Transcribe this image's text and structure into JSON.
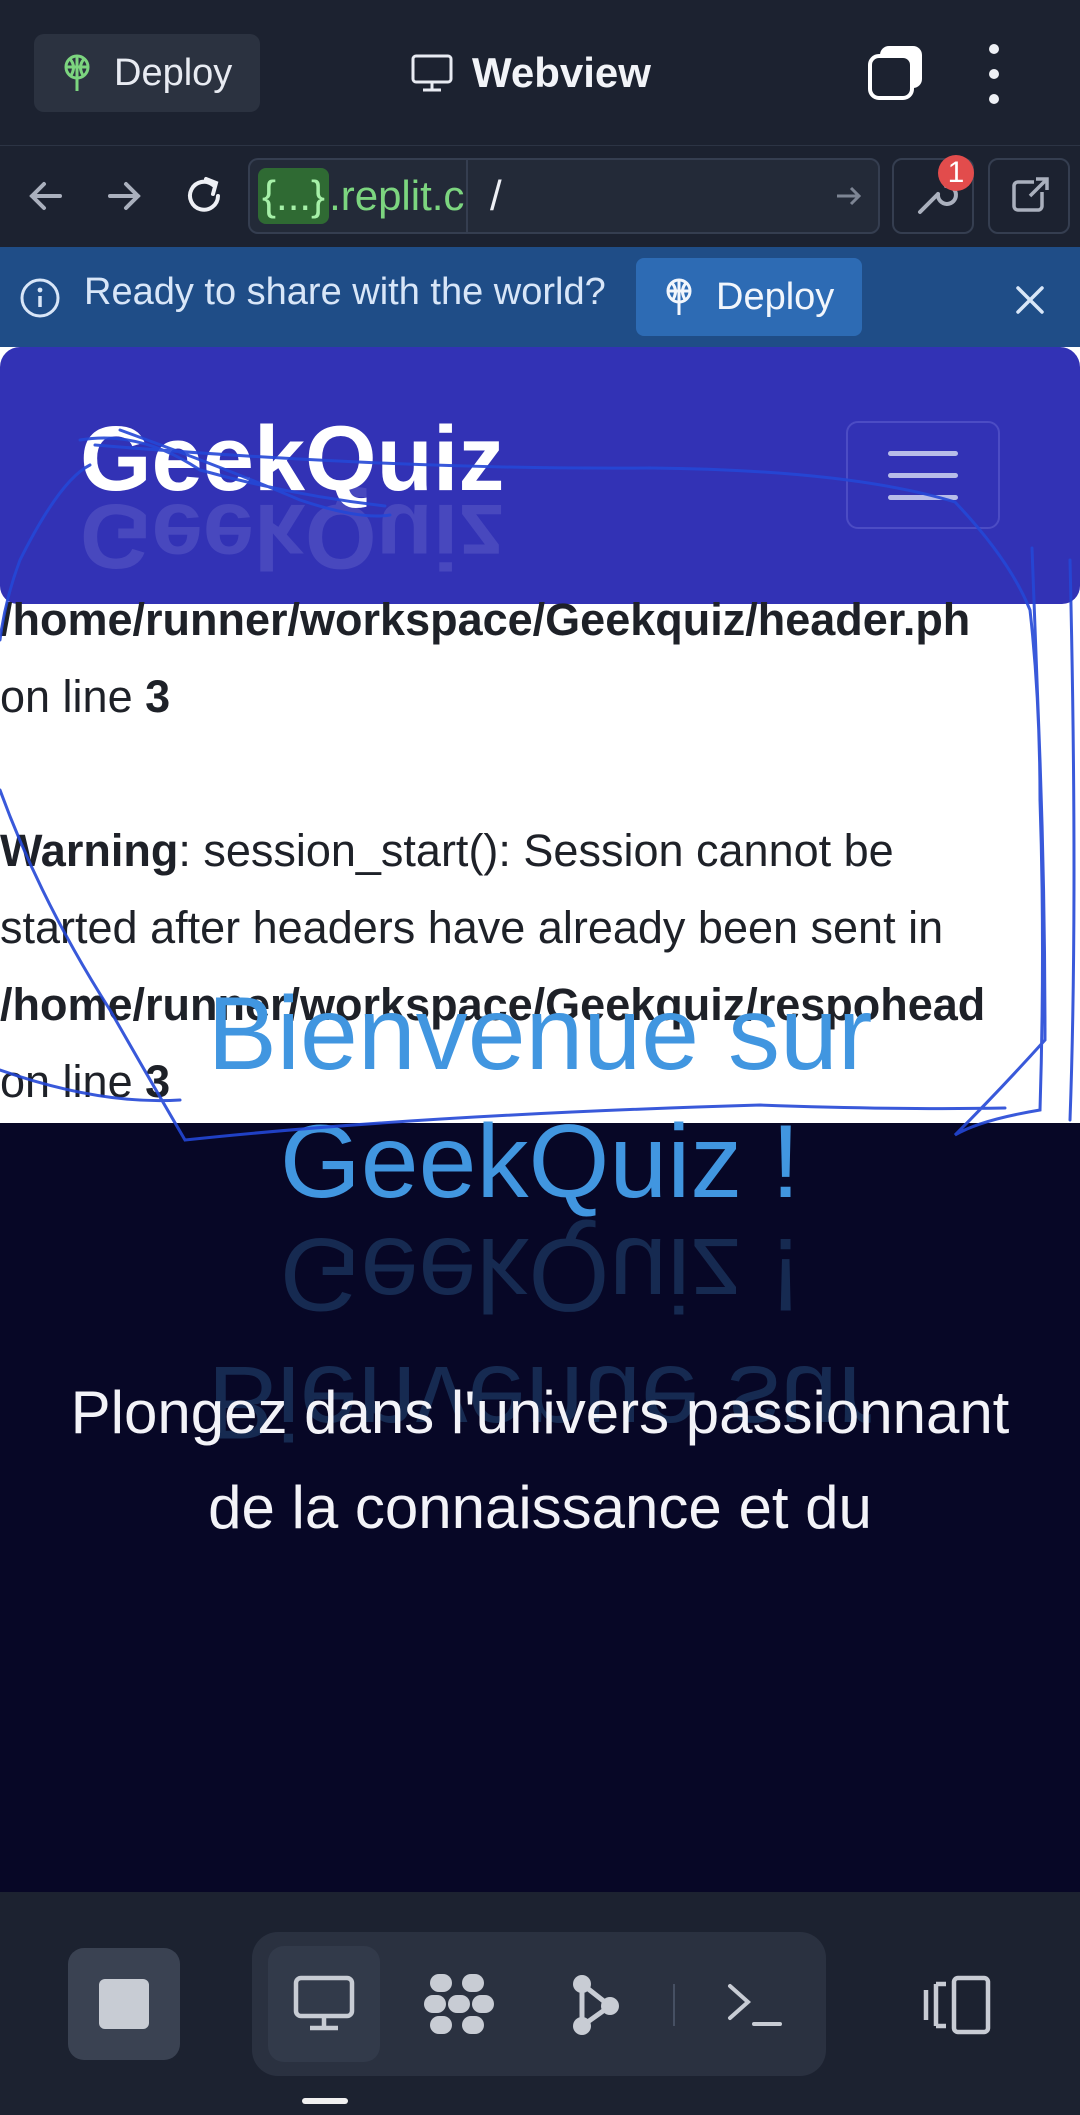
{
  "topbar": {
    "deploy_label": "Deploy",
    "title": "Webview"
  },
  "address_bar": {
    "host_badge": "{...}",
    "host_text": ".replit.c",
    "path": "/",
    "devtools_badge_count": "1"
  },
  "banner": {
    "text": "Ready to share with the world?",
    "deploy_label": "Deploy"
  },
  "site": {
    "brand": "GeekQuiz",
    "php_output": [
      {
        "bold": "/home/runner/workspace/Geekquiz/header.ph",
        "text": ""
      },
      {
        "prefix": "on line ",
        "bold": "3"
      },
      {
        "bold": "Warning",
        "text": ": session_start(): Session cannot be"
      },
      {
        "text": "started after headers have already been sent in"
      },
      {
        "bold": "/home/runner/workspace/Geekquiz/respohead",
        "text": ""
      },
      {
        "prefix": "on line ",
        "bold": "3"
      }
    ],
    "hero_title_line1": "Bienvenue sur",
    "hero_title_line2": "GeekQuiz !",
    "hero_sub_line1": "Plongez dans l'univers passionnant",
    "hero_sub_line2": "de la connaissance et du"
  },
  "colors": {
    "site_nav": "#3232b5",
    "hero_bg": "#070726",
    "hero_title": "#4196e0",
    "annotation_stroke": "#2447d6"
  }
}
